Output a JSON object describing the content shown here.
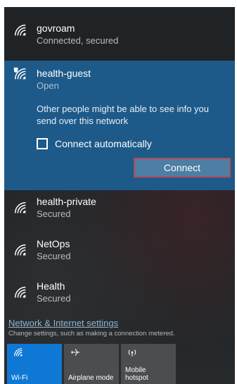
{
  "networks": [
    {
      "name": "govroam",
      "status": "Connected, secured"
    },
    {
      "name": "health-guest",
      "status": "Open"
    },
    {
      "name": "health-private",
      "status": "Secured"
    },
    {
      "name": "NetOps",
      "status": "Secured"
    },
    {
      "name": "Health",
      "status": "Secured"
    }
  ],
  "expanded": {
    "warning": "Other people might be able to see info you send over this network",
    "checkbox_label": "Connect automatically",
    "checkbox_checked": false,
    "connect_label": "Connect"
  },
  "settings": {
    "link": "Network & Internet settings",
    "description": "Change settings, such as making a connection metered."
  },
  "quick_actions": [
    {
      "label": "Wi-Fi",
      "icon": "wifi-icon",
      "active": true
    },
    {
      "label": "Airplane mode",
      "icon": "airplane-icon",
      "active": false
    },
    {
      "label": "Mobile hotspot",
      "icon": "hotspot-icon",
      "active": false
    }
  ],
  "colors": {
    "accent": "#0f78d4",
    "expanded_bg": "#1d5a8a",
    "connect_border": "#b84a57"
  }
}
